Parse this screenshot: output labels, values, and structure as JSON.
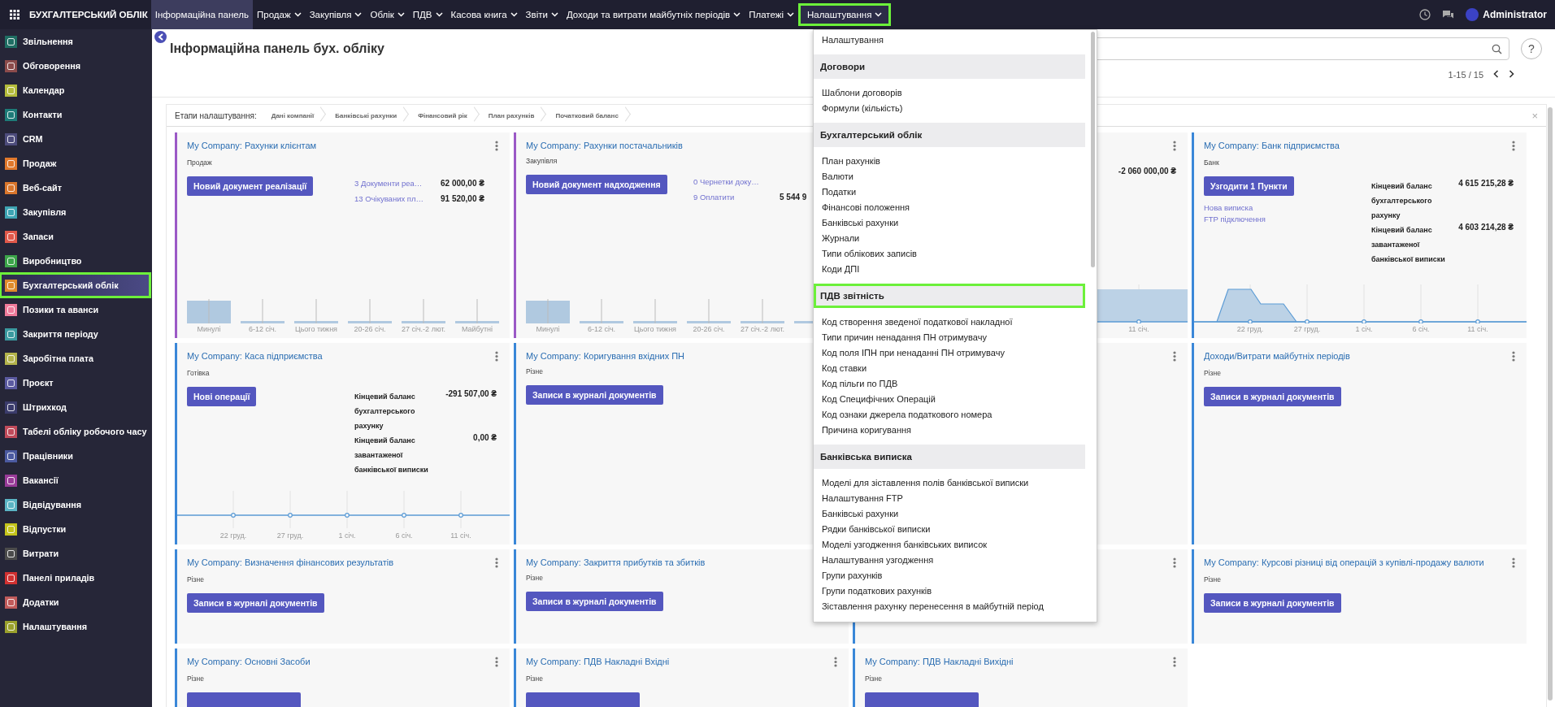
{
  "topbar": {
    "app_name": "БУХГАЛТЕРСЬКИЙ ОБЛІК",
    "user": "Administrator",
    "menu": [
      {
        "label": "Інформаційна панель",
        "selected": true,
        "dropdown": false,
        "highlighted": false
      },
      {
        "label": "Продаж",
        "selected": false,
        "dropdown": true,
        "highlighted": false
      },
      {
        "label": "Закупівля",
        "selected": false,
        "dropdown": true,
        "highlighted": false
      },
      {
        "label": "Облік",
        "selected": false,
        "dropdown": true,
        "highlighted": false
      },
      {
        "label": "ПДВ",
        "selected": false,
        "dropdown": true,
        "highlighted": false
      },
      {
        "label": "Касова книга",
        "selected": false,
        "dropdown": true,
        "highlighted": false
      },
      {
        "label": "Звіти",
        "selected": false,
        "dropdown": true,
        "highlighted": false
      },
      {
        "label": "Доходи та витрати майбутніх періодів",
        "selected": false,
        "dropdown": true,
        "highlighted": false
      },
      {
        "label": "Платежі",
        "selected": false,
        "dropdown": true,
        "highlighted": false
      },
      {
        "label": "Налаштування",
        "selected": false,
        "dropdown": true,
        "highlighted": true,
        "open": true,
        "submenu": [
          {
            "kind": "item",
            "label": "Налаштування"
          },
          {
            "kind": "header",
            "label": "Договори",
            "highlighted": false
          },
          {
            "kind": "item",
            "label": "Шаблони договорів"
          },
          {
            "kind": "item",
            "label": "Формули (кількість)"
          },
          {
            "kind": "header",
            "label": "Бухгалтерський облік",
            "highlighted": false
          },
          {
            "kind": "item",
            "label": "План рахунків"
          },
          {
            "kind": "item",
            "label": "Валюти"
          },
          {
            "kind": "item",
            "label": "Податки"
          },
          {
            "kind": "item",
            "label": "Фінансові положення"
          },
          {
            "kind": "item",
            "label": "Банківські рахунки"
          },
          {
            "kind": "item",
            "label": "Журнали"
          },
          {
            "kind": "item",
            "label": "Типи облікових записів"
          },
          {
            "kind": "item",
            "label": "Коди ДПІ"
          },
          {
            "kind": "header",
            "label": "ПДВ звітність",
            "highlighted": true
          },
          {
            "kind": "item",
            "label": "Код створення зведеної податкової накладної"
          },
          {
            "kind": "item",
            "label": "Типи причин ненадання ПН отримувачу"
          },
          {
            "kind": "item",
            "label": "Код поля ІПН при ненаданні ПН отримувачу"
          },
          {
            "kind": "item",
            "label": "Код ставки"
          },
          {
            "kind": "item",
            "label": "Код пільги по ПДВ"
          },
          {
            "kind": "item",
            "label": "Код Специфічних Операцій"
          },
          {
            "kind": "item",
            "label": "Код ознаки джерела податкового номера"
          },
          {
            "kind": "item",
            "label": "Причина коригування"
          },
          {
            "kind": "header",
            "label": "Банківська виписка",
            "highlighted": false
          },
          {
            "kind": "item",
            "label": "Моделі для зіставлення полів банківської виписки"
          },
          {
            "kind": "item",
            "label": "Налаштування FTP"
          },
          {
            "kind": "item",
            "label": "Банківські рахунки"
          },
          {
            "kind": "item",
            "label": "Рядки банківської виписки"
          },
          {
            "kind": "item",
            "label": "Моделі узгодження банківських виписок"
          },
          {
            "kind": "item",
            "label": "Налаштування узгодження"
          },
          {
            "kind": "item",
            "label": "Групи рахунків"
          },
          {
            "kind": "item",
            "label": "Групи податкових рахунків"
          },
          {
            "kind": "item",
            "label": "Зіставлення рахунку перенесення в майбутній період"
          }
        ]
      }
    ]
  },
  "sidebar": {
    "items": [
      {
        "label": "Звільнення",
        "color": "#1f6e63",
        "selected": false,
        "highlighted": false
      },
      {
        "label": "Обговорення",
        "color": "#8b4b4b",
        "selected": false,
        "highlighted": false
      },
      {
        "label": "Календар",
        "color": "#b4bc3c",
        "selected": false,
        "highlighted": false
      },
      {
        "label": "Контакти",
        "color": "#1d7b78",
        "selected": false,
        "highlighted": false
      },
      {
        "label": "CRM",
        "color": "#4d4c7c",
        "selected": false,
        "highlighted": false
      },
      {
        "label": "Продаж",
        "color": "#e0782c",
        "selected": false,
        "highlighted": false
      },
      {
        "label": "Веб-сайт",
        "color": "#d9762c",
        "selected": false,
        "highlighted": false
      },
      {
        "label": "Закупівля",
        "color": "#3ea4b3",
        "selected": false,
        "highlighted": false
      },
      {
        "label": "Запаси",
        "color": "#e0584a",
        "selected": false,
        "highlighted": false
      },
      {
        "label": "Виробництво",
        "color": "#3ca44a",
        "selected": false,
        "highlighted": false
      },
      {
        "label": "Бухгалтерський облік",
        "color": "#e08b2c",
        "selected": true,
        "highlighted": true
      },
      {
        "label": "Позики та аванси",
        "color": "#ef7b9b",
        "selected": false,
        "highlighted": false
      },
      {
        "label": "Закриття періоду",
        "color": "#3b9aa0",
        "selected": false,
        "highlighted": false
      },
      {
        "label": "Заробітна плата",
        "color": "#b3b34c",
        "selected": false,
        "highlighted": false
      },
      {
        "label": "Проєкт",
        "color": "#5b5aa0",
        "selected": false,
        "highlighted": false
      },
      {
        "label": "Штрихкод",
        "color": "#3b3c6c",
        "selected": false,
        "highlighted": false
      },
      {
        "label": "Табелі обліку робочого часу",
        "color": "#c04b5b",
        "selected": false,
        "highlighted": false
      },
      {
        "label": "Працівники",
        "color": "#4b5aa0",
        "selected": false,
        "highlighted": false
      },
      {
        "label": "Вакансії",
        "color": "#983b98",
        "selected": false,
        "highlighted": false
      },
      {
        "label": "Відвідування",
        "color": "#5bb4c4",
        "selected": false,
        "highlighted": false
      },
      {
        "label": "Відпустки",
        "color": "#c4c41c",
        "selected": false,
        "highlighted": false
      },
      {
        "label": "Витрати",
        "color": "#4b4b4b",
        "selected": false,
        "highlighted": false
      },
      {
        "label": "Панелі приладів",
        "color": "#d03131",
        "selected": false,
        "highlighted": false
      },
      {
        "label": "Додатки",
        "color": "#c05b5b",
        "selected": false,
        "highlighted": false
      },
      {
        "label": "Налаштування",
        "color": "#9aa02c",
        "selected": false,
        "highlighted": false
      }
    ]
  },
  "control_panel": {
    "title": "Інформаційна панель бух. обліку",
    "help": "?",
    "pager": "1-15 / 15"
  },
  "setup_bar": {
    "label": "Етапи налаштування:",
    "steps": [
      "Дані компанії",
      "Банківські рахунки",
      "Фінансовий рік",
      "План рахунків",
      "Початковий баланс"
    ],
    "close": "×"
  },
  "dashboard": {
    "cards": [
      {
        "kind": "sale",
        "title": "My Company: Рахунки клієнтам",
        "subtitle": "Продаж",
        "button": "Новий документ реалізації",
        "options_menu": true,
        "counts": [
          {
            "label": "3 Документи реа…",
            "amount": "62 000,00 ₴"
          },
          {
            "label": "13 Очікуваних пл…",
            "amount": "91 520,00 ₴"
          }
        ],
        "chart_labels": [
          "Минулі",
          "6-12 січ.",
          "Цього тижня",
          "20-26 січ.",
          "27 січ.-2 лют.",
          "Майбутні"
        ]
      },
      {
        "kind": "purchase",
        "title": "My Company: Рахунки постачальників",
        "subtitle": "Закупівля",
        "button": "Новий документ надходження",
        "options_menu": false,
        "counts": [
          {
            "label": "0 Чернетки доку…"
          },
          {
            "label": "9 Оплатити",
            "amount": "5 544 9"
          }
        ],
        "chart_labels": [
          "Минулі",
          "6-12 січ.",
          "Цього тижня",
          "20-26 січ.",
          "27 січ.-2 лют."
        ]
      },
      {
        "kind": "partial",
        "options_menu": true,
        "amount": "-2 060 000,00 ₴",
        "chart_labels": [
          "11 січ."
        ]
      },
      {
        "kind": "bank",
        "title": "My Company: Банк підприємства",
        "subtitle": "Банк",
        "button": "Узгодити 1 Пункти",
        "options_menu": true,
        "links": [
          "Нова виписка",
          "FTP підключення"
        ],
        "balances": [
          {
            "label": "Кінцевий баланс бухгалтерського рахунку",
            "amount": "4 615 215,28 ₴"
          },
          {
            "label": "Кінцевий баланс завантаженої банківської виписки",
            "amount": "4 603 214,28 ₴"
          }
        ],
        "chart_labels": [
          "22 груд.",
          "27 груд.",
          "1 січ.",
          "6 січ.",
          "11 січ."
        ]
      },
      {
        "kind": "cash",
        "title": "My Company: Каса підприємства",
        "subtitle": "Готівка",
        "button": "Нові операції",
        "options_menu": true,
        "balances": [
          {
            "label": "Кінцевий баланс бухгалтерського рахунку",
            "amount": "-291 507,00 ₴"
          },
          {
            "label": "Кінцевий баланс завантаженої банківської виписки",
            "amount": "0,00 ₴"
          }
        ],
        "chart_labels": [
          "22 груд.",
          "27 груд.",
          "1 січ.",
          "6 січ.",
          "11 січ."
        ]
      },
      {
        "kind": "general",
        "title": "My Company: Коригування вхідних ПН",
        "subtitle": "Різне",
        "button": "Записи в журналі документів",
        "options_menu": false
      },
      {
        "kind": "partial",
        "options_menu": true
      },
      {
        "kind": "general",
        "title": "Доходи/Витрати майбутніх періодів",
        "subtitle": "Різне",
        "button": "Записи в журналі документів",
        "options_menu": true
      },
      {
        "kind": "general",
        "title": "My Company: Визначення фінансових результатів",
        "subtitle": "Різне",
        "button": "Записи в журналі документів",
        "options_menu": true
      },
      {
        "kind": "general",
        "title": "My Company: Закриття прибутків та збитків",
        "subtitle": "Різне",
        "button": "Записи в журналі документів",
        "options_menu": false
      },
      {
        "kind": "partial",
        "options_menu": true
      },
      {
        "kind": "general",
        "title": "My Company: Курсові різниці від операцій з купівлі-продажу валюти",
        "subtitle": "Різне",
        "button": "Записи в журналі документів",
        "options_menu": true
      },
      {
        "kind": "general",
        "title": "My Company: Основні Засоби",
        "subtitle": "Різне",
        "button_truncated": true,
        "options_menu": true
      },
      {
        "kind": "general",
        "title": "My Company: ПДВ Накладні Вхідні",
        "subtitle": "Різне",
        "button_truncated": true,
        "options_menu": true
      },
      {
        "kind": "general",
        "title": "My Company: ПДВ Накладні Вихідні",
        "subtitle": "Різне",
        "button_truncated": true,
        "options_menu": true
      }
    ]
  }
}
